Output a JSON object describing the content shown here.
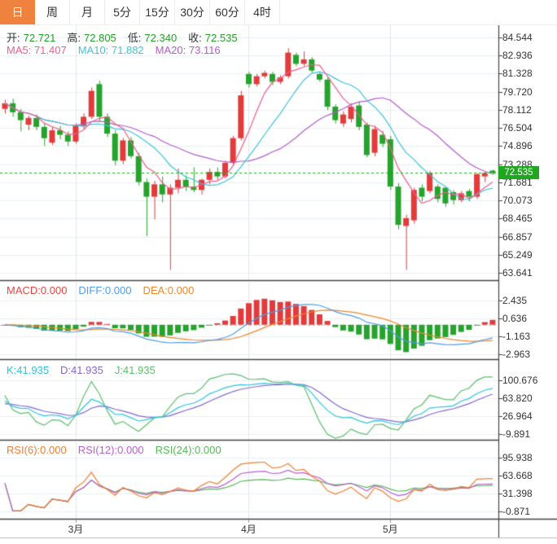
{
  "tabs": {
    "items": [
      {
        "label": "日",
        "name": "day",
        "active": true
      },
      {
        "label": "周",
        "name": "week",
        "active": false
      },
      {
        "label": "月",
        "name": "month",
        "active": false
      },
      {
        "label": "5分",
        "name": "5min",
        "active": false
      },
      {
        "label": "15分",
        "name": "15min",
        "active": false
      },
      {
        "label": "30分",
        "name": "30min",
        "active": false
      },
      {
        "label": "60分",
        "name": "60min",
        "active": false
      },
      {
        "label": "4时",
        "name": "4hour",
        "active": false
      }
    ]
  },
  "main_header": {
    "items": [
      {
        "label": "开:",
        "value": "72.721"
      },
      {
        "label": "高:",
        "value": "72.805"
      },
      {
        "label": "低:",
        "value": "72.340"
      },
      {
        "label": "收:",
        "value": "72.535"
      }
    ]
  },
  "ma_header": {
    "ma5": "MA5: 71.407",
    "ma10": "MA10: 71.882",
    "ma20": "MA20: 73.116"
  },
  "macd_header": {
    "macd": "MACD:0.000",
    "diff": "DIFF:0.000",
    "dea": "DEA:0.000"
  },
  "kdj_header": {
    "k": "K:41.935",
    "d": "D:41.935",
    "j": "J:41.935"
  },
  "rsi_header": {
    "rsi6": "RSI(6):0.000",
    "rsi12": "RSI(12):0.000",
    "rsi24": "RSI(24):0.000"
  },
  "price_badge": {
    "text": "72.535"
  },
  "colors": {
    "accent_tab": "#f0823f",
    "up": "#e23b3b",
    "down": "#26a32c",
    "value_green": "#21a321",
    "ma5": "#ef5d8e",
    "ma10": "#3fc3dc",
    "ma20": "#b55cc8",
    "macd": "#e8453f",
    "diff": "#4d9de8",
    "dea": "#f0872e",
    "k": "#2fc4dc",
    "d": "#8468d0",
    "j": "#5cc06c",
    "rsi6": "#f08030",
    "rsi12": "#bb5fd0",
    "rsi24": "#58b858",
    "price_line": "#1fa71f",
    "grid": "#e9eff5",
    "month_grid": "#e2e6ea",
    "zero_dash": "#8ad8e8",
    "frame": "#444444",
    "axis_text": "#333333"
  },
  "chart_data": {
    "type": "candlestick",
    "title": "",
    "panels": [
      "price_with_MA",
      "MACD",
      "KDJ",
      "RSI"
    ],
    "current_price": 72.535,
    "last_ohlc": {
      "open": 72.721,
      "high": 72.805,
      "low": 72.34,
      "close": 72.535
    },
    "indicator_params": {
      "ma": [
        5,
        10,
        20
      ],
      "macd": [
        12,
        26,
        9
      ],
      "kdj": [
        9,
        3,
        3
      ],
      "rsi": [
        6,
        12,
        24
      ]
    },
    "axes": {
      "main": [
        "84.544",
        "82.936",
        "81.328",
        "79.720",
        "78.112",
        "76.504",
        "74.896",
        "73.288",
        "71.681",
        "70.073",
        "68.465",
        "66.857",
        "65.249",
        "63.641"
      ],
      "macd": [
        "2.435",
        "0.636",
        "-1.163",
        "-2.963"
      ],
      "kdj": [
        "100.676",
        "63.820",
        "26.964",
        "-9.891"
      ],
      "rsi": [
        "95.938",
        "63.668",
        "31.398",
        "-0.871"
      ]
    },
    "month_marks": [
      {
        "label": "3月",
        "index": 9
      },
      {
        "label": "4月",
        "index": 31
      },
      {
        "label": "5月",
        "index": 49
      }
    ],
    "candles": [
      [
        78.2,
        79.0,
        77.8,
        78.7
      ],
      [
        78.7,
        79.1,
        77.5,
        77.9
      ],
      [
        77.9,
        78.2,
        76.2,
        77.2
      ],
      [
        76.8,
        77.6,
        76.3,
        77.4
      ],
      [
        77.4,
        77.7,
        76.3,
        76.6
      ],
      [
        76.6,
        76.9,
        74.9,
        75.6
      ],
      [
        75.2,
        76.6,
        75.0,
        76.3
      ],
      [
        76.3,
        76.7,
        75.5,
        75.9
      ],
      [
        75.9,
        76.2,
        74.9,
        75.3
      ],
      [
        75.3,
        76.9,
        75.1,
        76.7
      ],
      [
        76.7,
        77.8,
        76.4,
        77.5
      ],
      [
        77.5,
        80.1,
        77.3,
        79.8
      ],
      [
        80.4,
        80.7,
        77.1,
        77.5
      ],
      [
        77.5,
        77.8,
        75.7,
        76.0
      ],
      [
        76.0,
        76.3,
        73.2,
        73.6
      ],
      [
        73.6,
        75.6,
        73.3,
        75.4
      ],
      [
        75.4,
        75.7,
        73.8,
        74.0
      ],
      [
        74.0,
        74.3,
        71.4,
        71.7
      ],
      [
        71.7,
        72.0,
        66.9,
        70.4
      ],
      [
        70.4,
        71.8,
        68.4,
        71.5
      ],
      [
        71.5,
        72.2,
        69.9,
        70.6
      ],
      [
        70.6,
        71.5,
        63.9,
        71.2
      ],
      [
        71.2,
        72.9,
        70.7,
        71.9
      ],
      [
        71.9,
        72.3,
        70.9,
        71.3
      ],
      [
        71.3,
        73.0,
        70.8,
        71.0
      ],
      [
        71.0,
        72.0,
        70.6,
        71.9
      ],
      [
        71.9,
        72.9,
        71.5,
        72.6
      ],
      [
        72.6,
        73.0,
        71.9,
        72.2
      ],
      [
        72.2,
        73.6,
        72.0,
        73.4
      ],
      [
        73.4,
        75.8,
        73.2,
        75.6
      ],
      [
        75.6,
        79.8,
        75.4,
        79.4
      ],
      [
        81.3,
        81.5,
        80.1,
        80.4
      ],
      [
        80.4,
        81.3,
        80.2,
        81.1
      ],
      [
        81.1,
        81.6,
        80.9,
        81.4
      ],
      [
        81.3,
        81.5,
        80.3,
        80.6
      ],
      [
        80.6,
        81.2,
        80.4,
        81.0
      ],
      [
        81.1,
        83.6,
        80.9,
        83.2
      ],
      [
        83.0,
        83.2,
        82.0,
        82.2
      ],
      [
        82.2,
        83.3,
        82.0,
        82.6
      ],
      [
        82.6,
        82.8,
        81.4,
        81.6
      ],
      [
        81.3,
        81.5,
        80.6,
        80.8
      ],
      [
        80.8,
        81.0,
        78.1,
        78.4
      ],
      [
        78.4,
        78.6,
        76.9,
        77.2
      ],
      [
        76.9,
        78.0,
        76.6,
        77.7
      ],
      [
        77.3,
        78.7,
        77.0,
        78.4
      ],
      [
        78.5,
        78.8,
        76.3,
        76.6
      ],
      [
        76.8,
        77.0,
        73.9,
        74.1
      ],
      [
        74.3,
        76.7,
        74.0,
        76.4
      ],
      [
        75.9,
        76.2,
        74.8,
        75.1
      ],
      [
        75.5,
        75.8,
        71.0,
        71.3
      ],
      [
        71.3,
        71.6,
        67.5,
        67.9
      ],
      [
        67.8,
        68.8,
        63.9,
        68.5
      ],
      [
        68.3,
        71.2,
        68.0,
        71.0
      ],
      [
        71.2,
        71.5,
        70.0,
        70.4
      ],
      [
        70.9,
        72.7,
        70.7,
        72.5
      ],
      [
        71.3,
        71.5,
        69.9,
        70.2
      ],
      [
        71.2,
        71.3,
        69.5,
        69.8
      ],
      [
        70.8,
        71.0,
        69.7,
        70.1
      ],
      [
        70.1,
        70.9,
        69.9,
        70.7
      ],
      [
        70.9,
        71.1,
        70.0,
        70.4
      ],
      [
        70.4,
        72.5,
        70.2,
        72.4
      ],
      [
        72.2,
        72.6,
        71.7,
        72.5
      ],
      [
        72.721,
        72.805,
        72.34,
        72.535
      ]
    ]
  }
}
